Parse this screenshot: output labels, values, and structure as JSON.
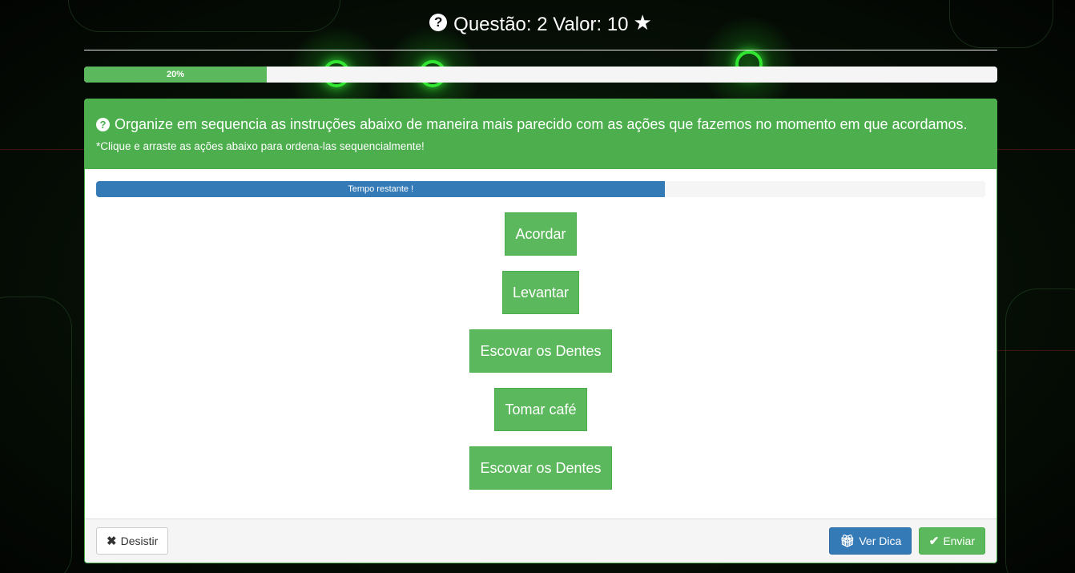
{
  "header": {
    "question_label": "Questão: 2 Valor: 10",
    "question_icon": "question-circle-icon",
    "star_icon": "star-icon"
  },
  "progress": {
    "value": 0.2,
    "label": "20%",
    "color": "#5cb85c"
  },
  "panel": {
    "instruction": "Organize em sequencia as instruções abaixo de maneira mais parecido com as ações que fazemos no momento em que acordamos.",
    "hint": "*Clique e arraste as ações abaixo para ordena-las sequencialmente!",
    "timer": {
      "label": "Tempo restante !",
      "value": 0.64,
      "color": "#337ab7"
    },
    "items": [
      "Acordar",
      "Levantar",
      "Escovar os Dentes",
      "Tomar café",
      "Escovar os Dentes"
    ]
  },
  "footer": {
    "give_up_label": "Desistir",
    "hint_label": "Ver Dica",
    "submit_label": "Enviar"
  },
  "colors": {
    "success": "#5cb85c",
    "heading": "#4cae4c",
    "primary": "#337ab7"
  }
}
